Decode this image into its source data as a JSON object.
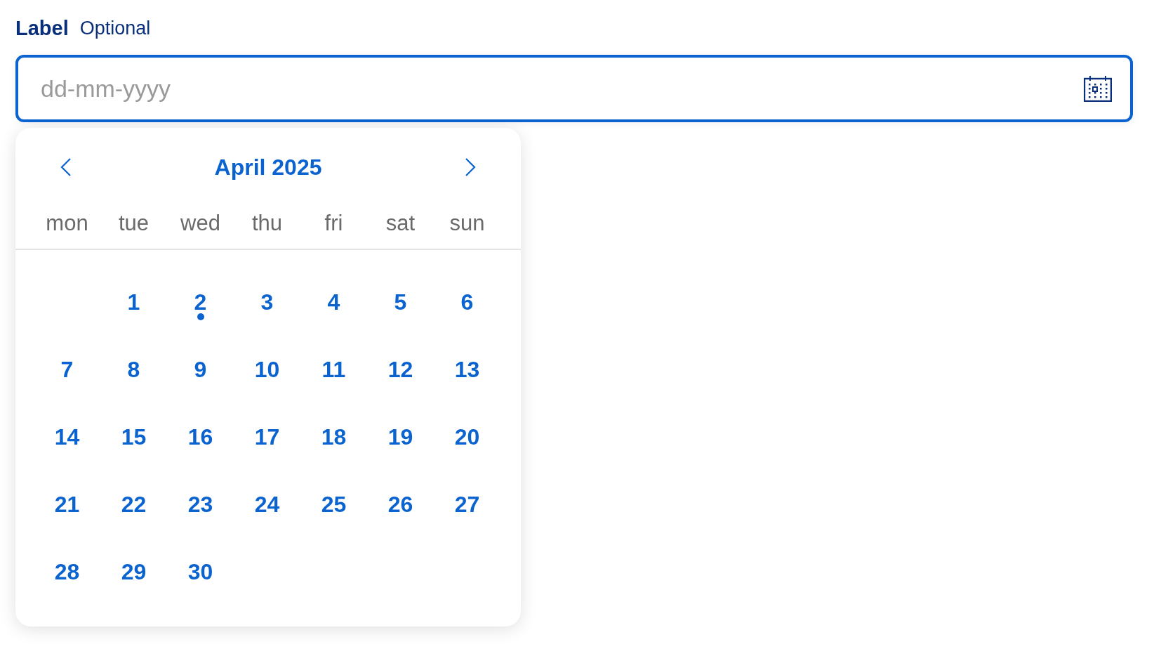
{
  "field": {
    "label": "Label",
    "hint": "Optional",
    "placeholder": "dd-mm-yyyy"
  },
  "calendar": {
    "month": "April 2025",
    "weekdays": [
      "mon",
      "tue",
      "wed",
      "thu",
      "fri",
      "sat",
      "sun"
    ],
    "weeks": [
      [
        {
          "day": "1",
          "today": false
        },
        {
          "day": "2",
          "today": true
        },
        {
          "day": "3",
          "today": false
        },
        {
          "day": "4",
          "today": false
        },
        {
          "day": "5",
          "today": false
        },
        {
          "day": "6",
          "today": false
        }
      ],
      [
        {
          "day": "7",
          "today": false
        },
        {
          "day": "8",
          "today": false
        },
        {
          "day": "9",
          "today": false
        },
        {
          "day": "10",
          "today": false
        },
        {
          "day": "11",
          "today": false
        },
        {
          "day": "12",
          "today": false
        },
        {
          "day": "13",
          "today": false
        }
      ],
      [
        {
          "day": "14",
          "today": false
        },
        {
          "day": "15",
          "today": false
        },
        {
          "day": "16",
          "today": false
        },
        {
          "day": "17",
          "today": false
        },
        {
          "day": "18",
          "today": false
        },
        {
          "day": "19",
          "today": false
        },
        {
          "day": "20",
          "today": false
        }
      ],
      [
        {
          "day": "21",
          "today": false
        },
        {
          "day": "22",
          "today": false
        },
        {
          "day": "23",
          "today": false
        },
        {
          "day": "24",
          "today": false
        },
        {
          "day": "25",
          "today": false
        },
        {
          "day": "26",
          "today": false
        },
        {
          "day": "27",
          "today": false
        }
      ],
      [
        {
          "day": "28",
          "today": false
        },
        {
          "day": "29",
          "today": false
        },
        {
          "day": "30",
          "today": false
        }
      ]
    ]
  }
}
